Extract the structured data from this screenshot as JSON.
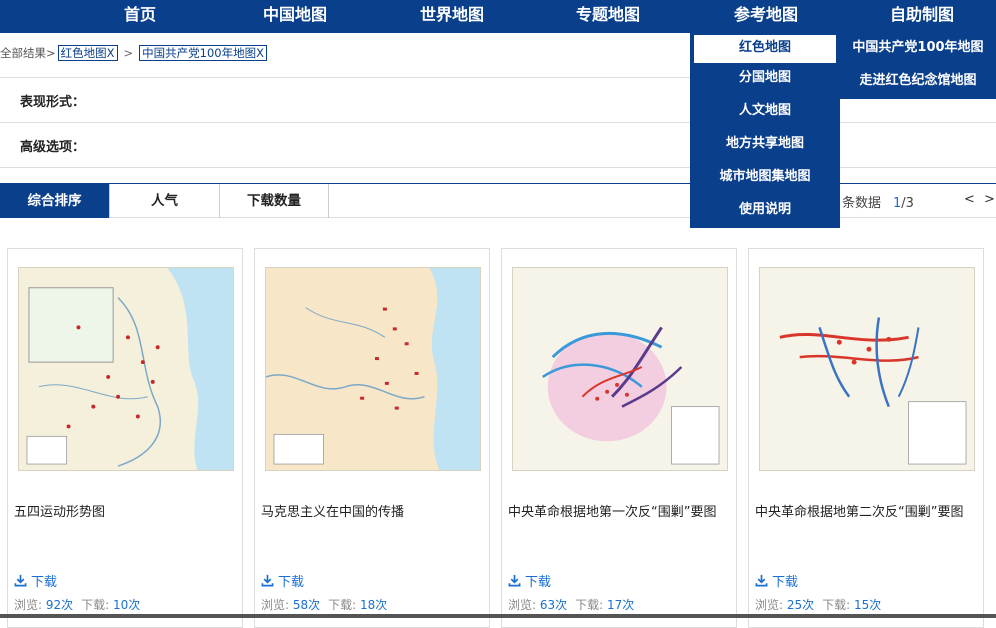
{
  "nav": {
    "items": [
      "首页",
      "中国地图",
      "世界地图",
      "专题地图",
      "参考地图",
      "自助制图"
    ]
  },
  "breadcrumb": {
    "root": "全部结果>",
    "sep": ">",
    "tags": [
      "红色地图X",
      "中国共产党100年地图X"
    ]
  },
  "filters": {
    "form_label": "表现形式：",
    "advanced_label": "高级选项："
  },
  "sort": {
    "tabs": [
      "综合排序",
      "人气",
      "下载数量"
    ],
    "count_suffix": "条数据",
    "page_current": "1",
    "page_total": "/3",
    "prev": "<",
    "next": ">"
  },
  "dropdown": {
    "items": [
      "红色地图",
      "分国地图",
      "人文地图",
      "地方共享地图",
      "城市地图集地图",
      "使用说明"
    ],
    "sub_items": [
      "中国共产党100年地图",
      "走进红色纪念馆地图"
    ]
  },
  "cards": [
    {
      "title": "五四运动形势图",
      "download": "下载",
      "views_label": "浏览:",
      "views": "92次",
      "downloads_label": "下载:",
      "downloads": "10次"
    },
    {
      "title": "马克思主义在中国的传播",
      "download": "下载",
      "views_label": "浏览:",
      "views": "58次",
      "downloads_label": "下载:",
      "downloads": "18次"
    },
    {
      "title": "中央革命根据地第一次反“围剿”要图",
      "download": "下载",
      "views_label": "浏览:",
      "views": "63次",
      "downloads_label": "下载:",
      "downloads": "17次"
    },
    {
      "title": "中央革命根据地第二次反“围剿”要图",
      "download": "下载",
      "views_label": "浏览:",
      "views": "25次",
      "downloads_label": "下载:",
      "downloads": "15次"
    }
  ],
  "colors": {
    "brand": "#0a3f8c",
    "link": "#1a6fd0"
  }
}
